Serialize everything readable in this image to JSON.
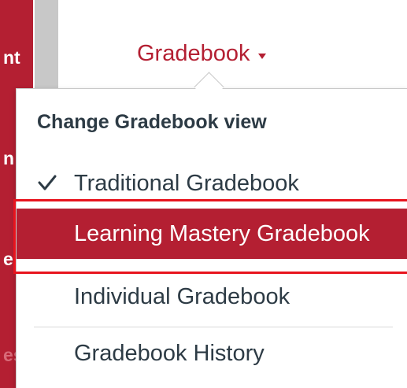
{
  "nav": {
    "fragments": [
      "nt",
      "n",
      "e",
      "es"
    ]
  },
  "header": {
    "gradebook_label": "Gradebook"
  },
  "menu": {
    "heading": "Change Gradebook view",
    "items": [
      {
        "label": "Traditional Gradebook",
        "checked": true
      },
      {
        "label": "Learning Mastery Gradebook",
        "highlighted": true
      },
      {
        "label": "Individual Gradebook"
      },
      {
        "label": "Gradebook History"
      }
    ]
  },
  "colors": {
    "brand_red": "#b41f32",
    "annotation_red": "#e8141e",
    "text_dark": "#2d3b45"
  },
  "icons": {
    "caret": "caret-down-icon",
    "check": "checkmark-icon"
  }
}
